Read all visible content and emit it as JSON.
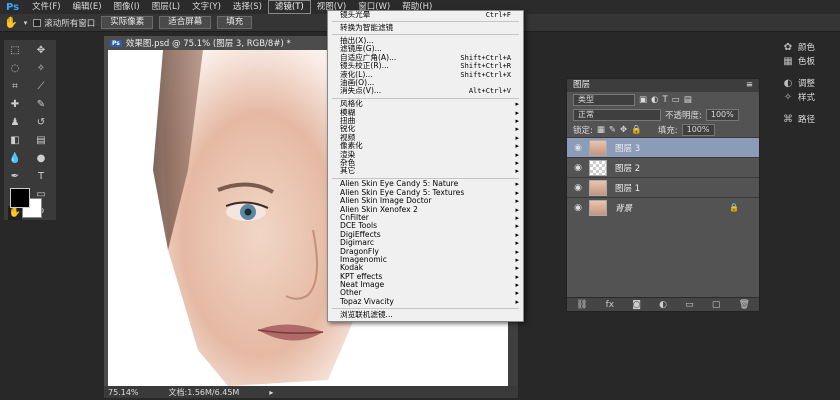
{
  "app": {
    "logo": "Ps"
  },
  "menubar": [
    "文件(F)",
    "编辑(E)",
    "图像(I)",
    "图层(L)",
    "文字(Y)",
    "选择(S)",
    "滤镜(T)",
    "视图(V)",
    "窗口(W)",
    "帮助(H)"
  ],
  "options": {
    "scroll_all": "滚动所有窗口",
    "actual_pixels": "实际像素",
    "fit_screen": "适合屏幕",
    "fill_screen": "填充"
  },
  "document": {
    "tab_badge": "Ps",
    "tab_title": "效果图.psd @ 75.1% (图层 3, RGB/8#) *",
    "zoom": "75.14%",
    "doc_info": "文档:1.56M/6.45M"
  },
  "filter_menu": {
    "group1": [
      {
        "label": "镜头光晕",
        "shortcut": "Ctrl+F"
      }
    ],
    "group2": [
      {
        "label": "转换为智能滤镜",
        "shortcut": ""
      }
    ],
    "group3": [
      {
        "label": "抽出(X)...",
        "shortcut": ""
      },
      {
        "label": "滤镜库(G)...",
        "shortcut": ""
      },
      {
        "label": "自适应广角(A)...",
        "shortcut": "Shift+Ctrl+A"
      },
      {
        "label": "镜头校正(R)...",
        "shortcut": "Shift+Ctrl+R"
      },
      {
        "label": "液化(L)...",
        "shortcut": "Shift+Ctrl+X"
      },
      {
        "label": "油画(O)...",
        "shortcut": ""
      },
      {
        "label": "消失点(V)...",
        "shortcut": "Alt+Ctrl+V"
      }
    ],
    "group4": [
      "风格化",
      "模糊",
      "扭曲",
      "锐化",
      "视频",
      "像素化",
      "渲染",
      "杂色",
      "其它"
    ],
    "group5": [
      "Alien Skin Eye Candy 5: Nature",
      "Alien Skin Eye Candy 5: Textures",
      "Alien Skin Image Doctor",
      "Alien Skin Xenofex 2",
      "CnFilter",
      "DCE Tools",
      "DigiEffects",
      "Digimarc",
      "DragonFly",
      "Imagenomic",
      "Kodak",
      "KPT effects",
      "Neat Image",
      "Other",
      "Topaz Vivacity"
    ],
    "group6": [
      "浏览联机滤镜..."
    ]
  },
  "right_icons": [
    "颜色",
    "色板",
    "调整",
    "样式",
    "路径"
  ],
  "layers_panel": {
    "title": "图层",
    "filter_label": "类型",
    "blend_mode": "正常",
    "opacity_label": "不透明度:",
    "opacity_value": "100%",
    "lock_label": "锁定:",
    "fill_label": "填充:",
    "fill_value": "100%",
    "layers": [
      {
        "name": "图层 3",
        "selected": true
      },
      {
        "name": "图层 2",
        "selected": false
      },
      {
        "name": "图层 1",
        "selected": false
      },
      {
        "name": "背景",
        "selected": false
      }
    ]
  }
}
